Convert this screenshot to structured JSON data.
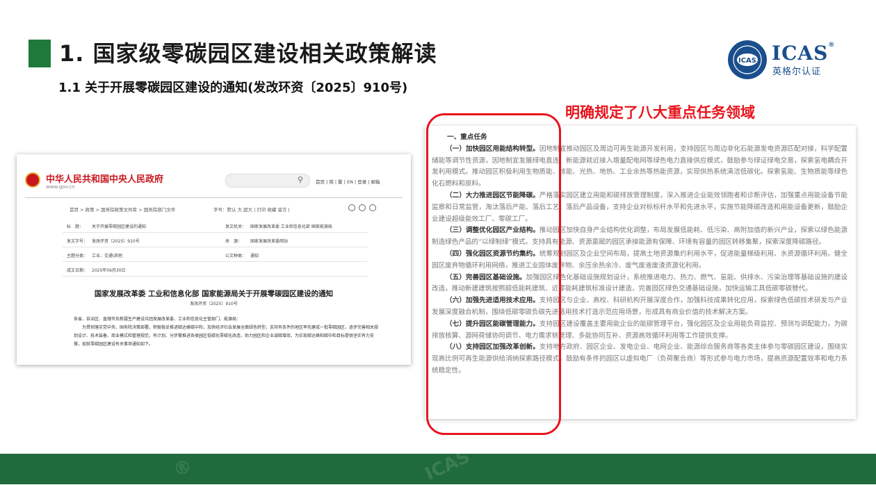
{
  "slide": {
    "title": "1. 国家级零碳园区建设相关政策解读",
    "subtitle": "1.1 关于开展零碳园区建设的通知(发改环资〔2025〕910号)",
    "callout": "明确规定了八大重点任务领域",
    "accent_color": "#1e7a3a",
    "callout_color": "#e8141c"
  },
  "logo": {
    "brand": "ICAS",
    "reg": "®",
    "cn_name": "英格尔认证"
  },
  "gov_page": {
    "site_name": "中华人民共和国中央人民政府",
    "site_url": "www.gov.cn",
    "nav": "首页 | 简 | 繁 | EN | 登录 | 邮箱",
    "breadcrumb": "首页 > 政策 > 国务院政策文件库 > 国务院部门文件",
    "tools": "字号：默认 大 超大 | 打印 收藏 留言 |",
    "meta": [
      {
        "label": "标　题：",
        "value": "关于开展零碳园区建设的通知",
        "label2": "发文机关：",
        "value2": "国家发展改革委 工业和信息化部 国家能源局"
      },
      {
        "label": "发文字号：",
        "value": "发改环资〔2025〕910号",
        "label2": "来　源：",
        "value2": "国家发展改革委网站"
      },
      {
        "label": "主题分类：",
        "value": "工业、交通\\其他",
        "label2": "公文种类：",
        "value2": "通知"
      },
      {
        "label": "成文日期：",
        "value": "2025年06月30日",
        "label2": "",
        "value2": ""
      }
    ],
    "doc_title": "国家发展改革委 工业和信息化部 国家能源局关于开展零碳园区建设的通知",
    "doc_no": "发改环资〔2025〕910号",
    "salutation": "各省、自治区、直辖市及新疆生产建设兵团发展改革委、工业和信息化主管部门、能源局：",
    "body": "为贯彻落实党中央、国务院决策部署，积极稳妥推进碳达峰碳中和，加快经济社会发展全面绿色转型，支持有条件的地区率先建成一批零碳园区，逐步完善相关规划设计、技术装备、商业模式和管理规范，有计划、分步骤推进各类园区低碳化零碳化改造，助力园区和企业减碳增效，为实现碳达峰和碳中和目标提供坚实有力支撑，现就零碳园区建设有关事项通知如下。"
  },
  "tasks_doc": {
    "section": "一、重点任务",
    "tasks": [
      {
        "title": "（一）加快园区用能结构转型。",
        "text": "因地制宜推动园区及周边可再生能源开发利用，支持园区与周边非化石能源发电资源匹配对接，科学配置储能等调节性资源，因地制宜发展绿电直连、新能源就近接入增量配电网等绿色电力直接供应模式，鼓励参与绿证绿电交易，探索氢电耦合开发利用模式。推动园区积极利用生物质能、核能、光热、地热、工业余热等热能资源，实现供热系统清洁低碳化。探索氢能、生物质能等绿色化石燃料和原料。"
      },
      {
        "title": "（二）大力推进园区节能降碳。",
        "text": "严格落实园区建立用能和碳排放管理制度，深入推进企业能效领跑者和诊断评估，加强重点用能设备节能监察和日常监管，淘汰落后产能、落后工艺、落后产品设备，支持企业对标标杆水平和先进水平，实施节能降碳改造和用能设备更新，鼓励企业建设超级能效工厂、零碳工厂。"
      },
      {
        "title": "（三）调整优化园区产业结构。",
        "text": "推动园区加快自身产业结构优化调整，布局发展低能耗、低污染、高附加值的新兴产业，探索以绿色能源制造绿色产品的“以绿制绿”模式。支持具有能源、资源禀赋的园区承接能源有保障、环境有容量的园区转移集聚，探索深度降碳路径。"
      },
      {
        "title": "（四）强化园区资源节约集约。",
        "text": "统筹规划园区及企业空间布局，提高土地资源集约利用水平，促进能量梯级利用、水资源循环利用。健全园区废弃物循环利用网络，推进工业固体废弃物、余压余热余冷、废气废液废渣资源化利用。"
      },
      {
        "title": "（五）完善园区基础设施。",
        "text": "加强园区绿色化基础设施规划设计，系统推进电力、热力、燃气、氢能、供排水、污染治理等基础设施的建设改造，推动新建建筑按照超低能耗建筑、近零能耗建筑标准设计建造，完善园区绿色交通基础设施，加快运输工具低碳零碳替代。"
      },
      {
        "title": "（六）加强先进适用技术应用。",
        "text": "支持园区与企业、高校、科研机构开展深度合作，加强科技成果转化应用，探索绿色低碳技术研发与产业发展深度融合机制，围绕低碳零碳负碳先进适用技术打造示范应用场景，形成具有商业价值的技术解决方案。"
      },
      {
        "title": "（七）提升园区能碳管理能力。",
        "text": "支持园区建设覆盖主要用能企业的能碳管理平台，强化园区及企业用能负荷监控、预测与调配能力，为碳排放核算、源网荷储协同调节、电力需求侧管理、多能协同互补、资源高效循环利用等工作提供支撑。"
      },
      {
        "title": "（八）支持园区加强改革创新。",
        "text": "支持地方政府、园区企业、发电企业、电网企业、能源综合服务商等各类主体参与零碳园区建设，围绕实现高比例可再生能源供给消纳探索路径模式。鼓励有条件的园区以虚拟电厂（负荷聚合商）等形式参与电力市场，提高资源配置效率和电力系统稳定性。"
      }
    ]
  }
}
